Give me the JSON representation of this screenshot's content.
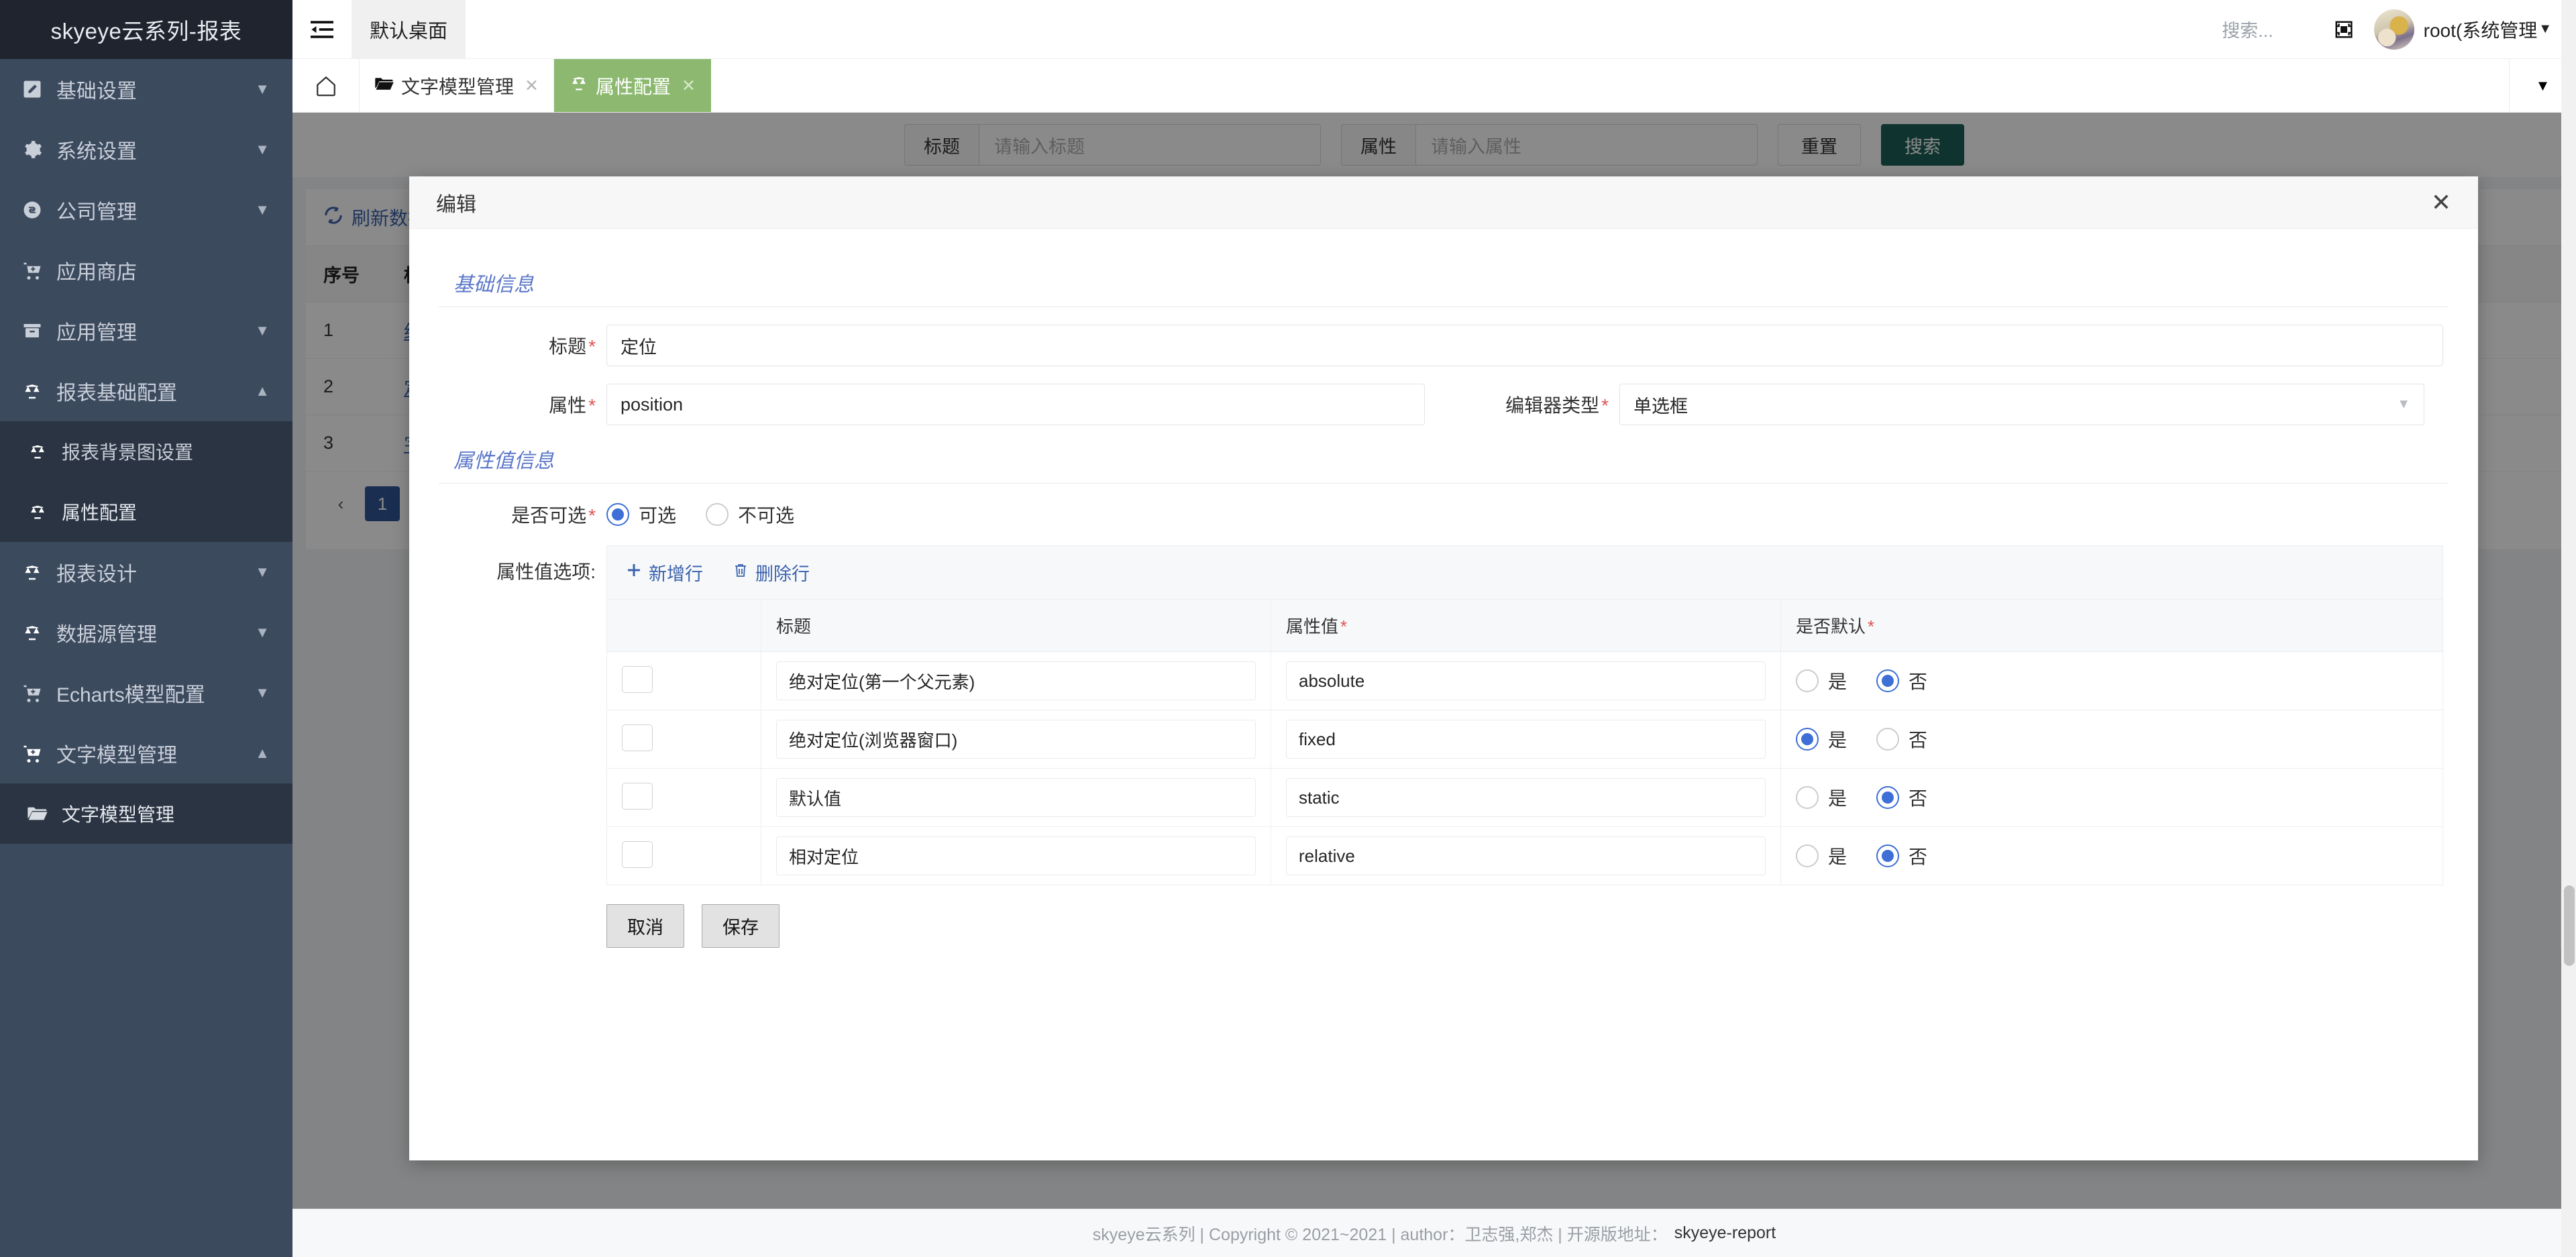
{
  "brand": {
    "title": "skyeye云系列-报表"
  },
  "sidebar": {
    "items": [
      {
        "label": "基础设置",
        "icon": "edit-square-icon",
        "arrow": "▼",
        "level": "top"
      },
      {
        "label": "系统设置",
        "icon": "gear-icon",
        "arrow": "▼",
        "level": "top"
      },
      {
        "label": "公司管理",
        "icon": "company-icon",
        "arrow": "▼",
        "level": "top"
      },
      {
        "label": "应用商店",
        "icon": "cart-icon",
        "arrow": "",
        "level": "top"
      },
      {
        "label": "应用管理",
        "icon": "box-icon",
        "arrow": "▼",
        "level": "top"
      },
      {
        "label": "报表基础配置",
        "icon": "scale-icon",
        "arrow": "▲",
        "level": "top"
      },
      {
        "label": "报表背景图设置",
        "icon": "scale-icon",
        "arrow": "",
        "level": "sub"
      },
      {
        "label": "属性配置",
        "icon": "scale-icon",
        "arrow": "",
        "level": "sub"
      },
      {
        "label": "报表设计",
        "icon": "scale-icon",
        "arrow": "▼",
        "level": "top"
      },
      {
        "label": "数据源管理",
        "icon": "scale-icon",
        "arrow": "▼",
        "level": "top"
      },
      {
        "label": "Echarts模型配置",
        "icon": "cart-icon",
        "arrow": "▼",
        "level": "top"
      },
      {
        "label": "文字模型管理",
        "icon": "cart-icon",
        "arrow": "▲",
        "level": "top"
      },
      {
        "label": "文字模型管理",
        "icon": "folder-icon",
        "arrow": "",
        "level": "sub"
      }
    ]
  },
  "topbar": {
    "collapse_icon": "menu-collapse-icon",
    "desktop_tab": "默认桌面",
    "search_placeholder": "搜索...",
    "fullscreen_icon": "fullscreen-icon",
    "user_name": "root(系统管理",
    "user_caret": "▼"
  },
  "tabstrip": {
    "home_icon": "home-icon",
    "tabs": [
      {
        "label": "文字模型管理",
        "icon": "folder-icon",
        "close": "✕",
        "active": false
      },
      {
        "label": "属性配置",
        "icon": "scale-icon",
        "close": "✕",
        "active": true
      }
    ],
    "more_caret": "▼"
  },
  "search_bar": {
    "title_label": "标题",
    "title_placeholder": "请输入标题",
    "attr_label": "属性",
    "attr_placeholder": "请输入属性",
    "reset_label": "重置",
    "search_label": "搜索"
  },
  "list_panel": {
    "refresh_label": "刷新数据",
    "refresh_icon": "refresh-icon",
    "columns": [
      "序号",
      "标题"
    ],
    "rows": [
      {
        "no": "1",
        "title": "红色"
      },
      {
        "no": "2",
        "title": "定位"
      },
      {
        "no": "3",
        "title": "字体"
      }
    ],
    "pager": {
      "prev": "‹",
      "pages": [
        "1"
      ],
      "current": "1"
    }
  },
  "modal": {
    "title": "编辑",
    "close_icon": "close-icon",
    "section_basic": "基础信息",
    "section_values": "属性值信息",
    "fields": {
      "title_label": "标题",
      "title_value": "定位",
      "attr_label": "属性",
      "attr_value": "position",
      "editor_type_label": "编辑器类型",
      "editor_type_value": "单选框",
      "editor_type_caret": "▼"
    },
    "selectable": {
      "label": "是否可选",
      "options": [
        {
          "label": "可选",
          "selected": true
        },
        {
          "label": "不可选",
          "selected": false
        }
      ]
    },
    "options_label": "属性值选项:",
    "actions": {
      "add_row": "新增行",
      "add_icon": "plus-icon",
      "delete_row": "删除行",
      "delete_icon": "trash-icon"
    },
    "table": {
      "columns": [
        "",
        "标题",
        "属性值",
        "是否默认"
      ],
      "required_cols": [
        false,
        false,
        true,
        true
      ],
      "yes_label": "是",
      "no_label": "否",
      "rows": [
        {
          "checked": false,
          "title": "绝对定位(第一个父元素)",
          "value": "absolute",
          "is_default": false
        },
        {
          "checked": false,
          "title": "绝对定位(浏览器窗口)",
          "value": "fixed",
          "is_default": true
        },
        {
          "checked": false,
          "title": "默认值",
          "value": "static",
          "is_default": false
        },
        {
          "checked": false,
          "title": "相对定位",
          "value": "relative",
          "is_default": false
        }
      ]
    },
    "buttons": {
      "cancel": "取消",
      "save": "保存"
    }
  },
  "footer": {
    "text": "skyeye云系列 | Copyright © 2021~2021 | author：卫志强,郑杰 | 开源版地址：",
    "link": "skyeye-report"
  },
  "colors": {
    "sidebar_bg": "#3c4a5e",
    "brand_bg": "#20242e",
    "tab_active": "#8cb96f",
    "primary_btn": "#1c6158",
    "radio_blue": "#3d6fd6",
    "link_blue": "#3b63ad",
    "section_title": "#5b77c8",
    "scroll_green": "#35b45a"
  }
}
